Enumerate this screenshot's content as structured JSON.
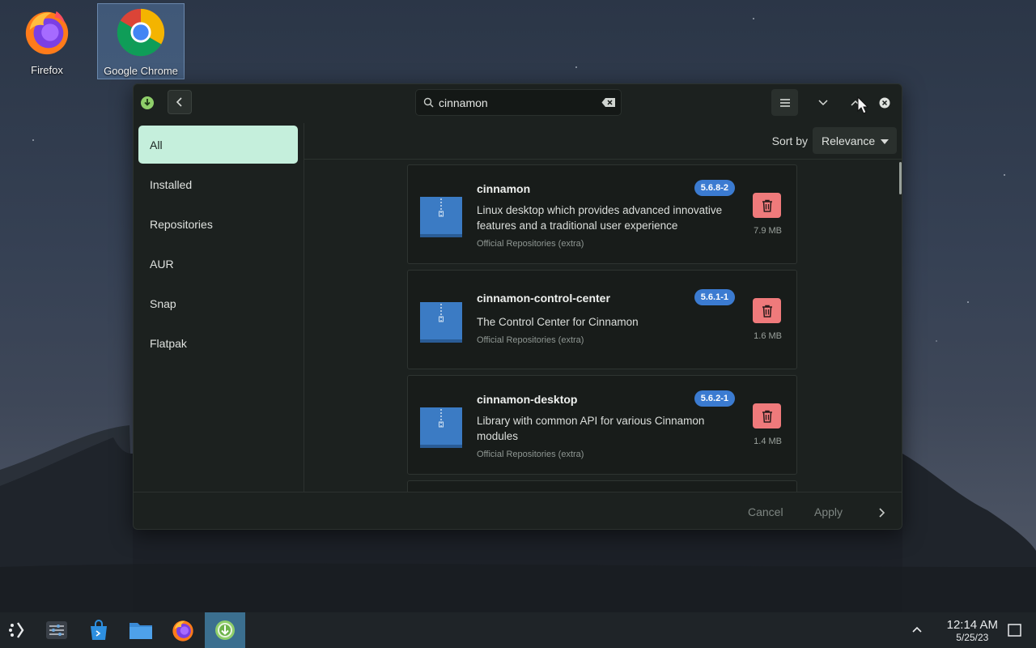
{
  "desktop": {
    "icons": [
      {
        "label": "Firefox"
      },
      {
        "label": "Google Chrome"
      }
    ]
  },
  "window": {
    "search": {
      "value": "cinnamon",
      "placeholder": ""
    },
    "sidebar": {
      "items": [
        {
          "label": "All",
          "active": true
        },
        {
          "label": "Installed"
        },
        {
          "label": "Repositories"
        },
        {
          "label": "AUR"
        },
        {
          "label": "Snap"
        },
        {
          "label": "Flatpak"
        }
      ]
    },
    "sort": {
      "label": "Sort by",
      "value": "Relevance"
    },
    "packages": [
      {
        "name": "cinnamon",
        "version": "5.6.8-2",
        "description": "Linux desktop which provides advanced innovative features and a traditional user experience",
        "repo": "Official Repositories (extra)",
        "size": "7.9 MB"
      },
      {
        "name": "cinnamon-control-center",
        "version": "5.6.1-1",
        "description": "The Control Center for Cinnamon",
        "repo": "Official Repositories (extra)",
        "size": "1.6 MB"
      },
      {
        "name": "cinnamon-desktop",
        "version": "5.6.2-1",
        "description": "Library with common API for various Cinnamon modules",
        "repo": "Official Repositories (extra)",
        "size": "1.4 MB"
      }
    ],
    "footer": {
      "cancel": "Cancel",
      "apply": "Apply"
    }
  },
  "taskbar": {
    "time": "12:14 AM",
    "date": "5/25/23"
  },
  "colors": {
    "accent_active_nav": "#c5efdc",
    "badge": "#3b7bd1",
    "delete": "#ef7a7b",
    "taskbar_active": "#3b6f8f"
  }
}
